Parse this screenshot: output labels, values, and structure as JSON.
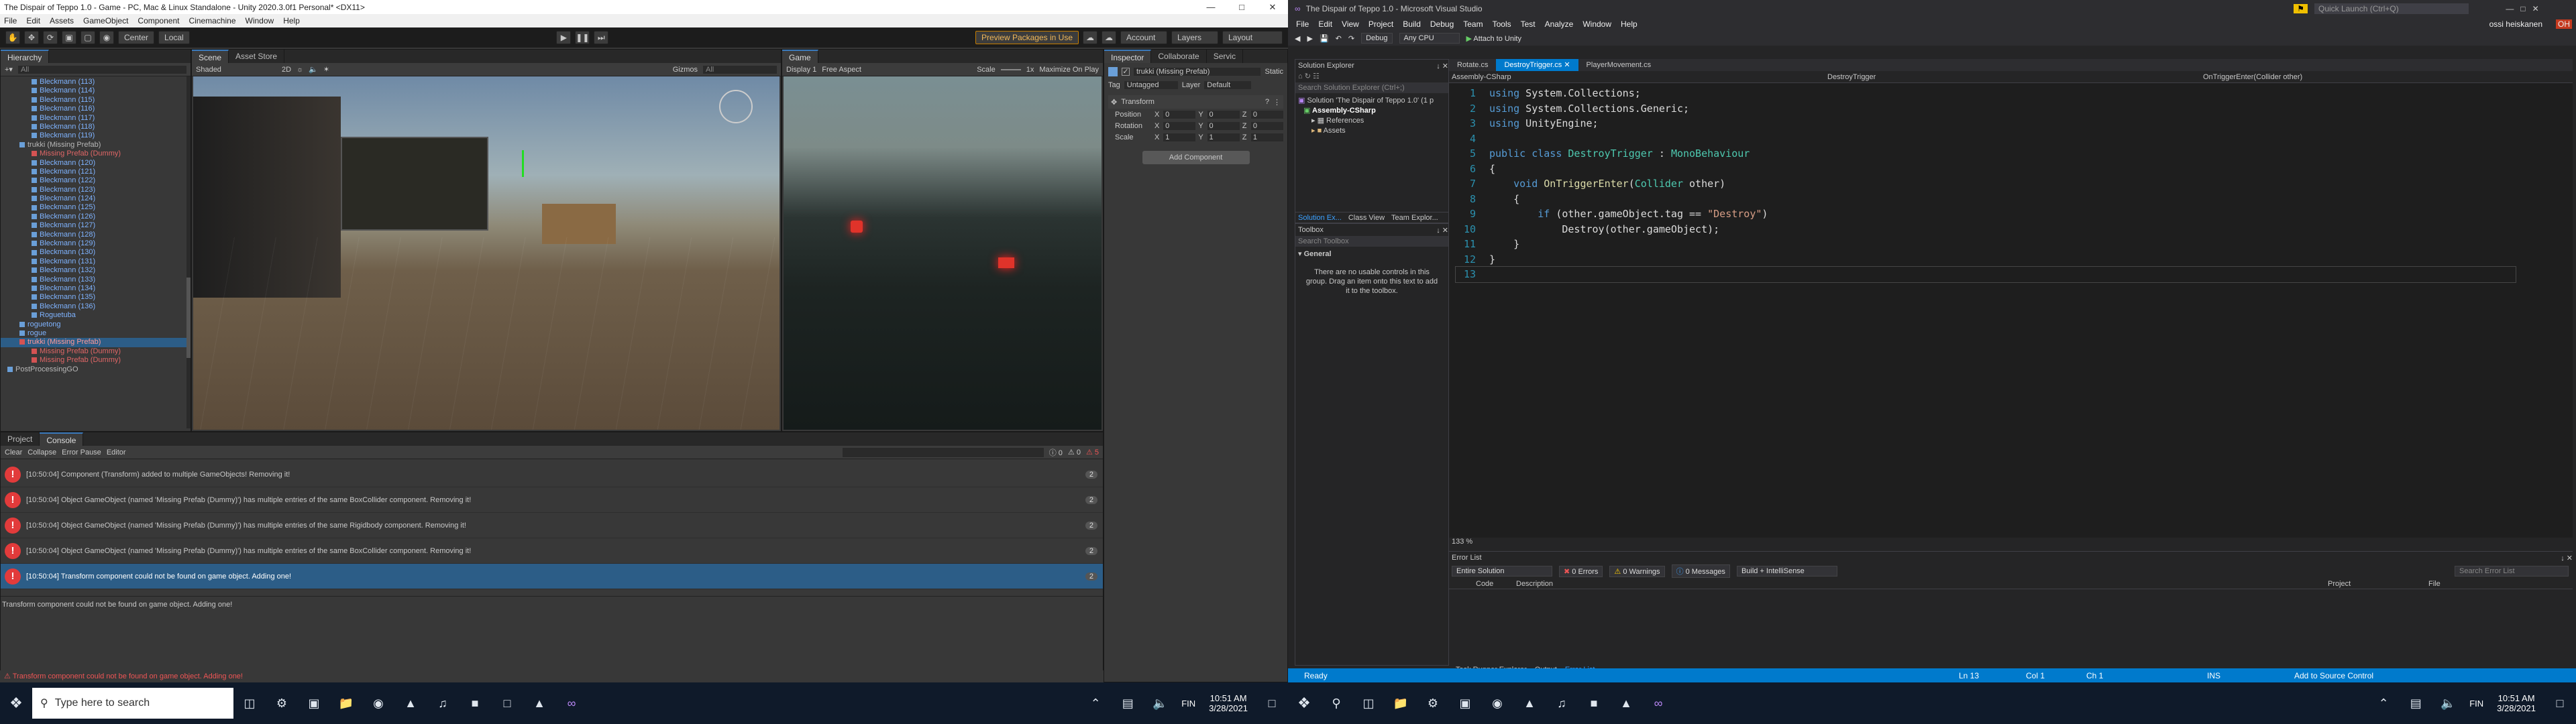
{
  "unity": {
    "title": "The Dispair of Teppo 1.0 - Game - PC, Mac & Linux Standalone - Unity 2020.3.0f1 Personal* <DX11>",
    "menu": [
      "File",
      "Edit",
      "Assets",
      "GameObject",
      "Component",
      "Cinemachine",
      "Window",
      "Help"
    ],
    "toolbar": {
      "center": "Center",
      "local": "Local",
      "preview": "Preview Packages in Use",
      "account": "Account",
      "layers": "Layers",
      "layout": "Layout"
    },
    "hierarchy": {
      "tab": "Hierarchy",
      "search_placeholder": "All",
      "items": [
        {
          "label": "Bleckmann (113)",
          "type": "blue",
          "indent": 2
        },
        {
          "label": "Bleckmann (114)",
          "type": "blue",
          "indent": 2
        },
        {
          "label": "Bleckmann (115)",
          "type": "blue",
          "indent": 2
        },
        {
          "label": "Bleckmann (116)",
          "type": "blue",
          "indent": 2
        },
        {
          "label": "Bleckmann (117)",
          "type": "blue",
          "indent": 2
        },
        {
          "label": "Bleckmann (118)",
          "type": "blue",
          "indent": 2
        },
        {
          "label": "Bleckmann (119)",
          "type": "blue",
          "indent": 2
        },
        {
          "label": "trukki (Missing Prefab)",
          "type": "plain",
          "indent": 1
        },
        {
          "label": "Missing Prefab (Dummy)",
          "type": "red",
          "indent": 2
        },
        {
          "label": "Bleckmann (120)",
          "type": "blue",
          "indent": 2
        },
        {
          "label": "Bleckmann (121)",
          "type": "blue",
          "indent": 2
        },
        {
          "label": "Bleckmann (122)",
          "type": "blue",
          "indent": 2
        },
        {
          "label": "Bleckmann (123)",
          "type": "blue",
          "indent": 2
        },
        {
          "label": "Bleckmann (124)",
          "type": "blue",
          "indent": 2
        },
        {
          "label": "Bleckmann (125)",
          "type": "blue",
          "indent": 2
        },
        {
          "label": "Bleckmann (126)",
          "type": "blue",
          "indent": 2
        },
        {
          "label": "Bleckmann (127)",
          "type": "blue",
          "indent": 2
        },
        {
          "label": "Bleckmann (128)",
          "type": "blue",
          "indent": 2
        },
        {
          "label": "Bleckmann (129)",
          "type": "blue",
          "indent": 2
        },
        {
          "label": "Bleckmann (130)",
          "type": "blue",
          "indent": 2
        },
        {
          "label": "Bleckmann (131)",
          "type": "blue",
          "indent": 2
        },
        {
          "label": "Bleckmann (132)",
          "type": "blue",
          "indent": 2
        },
        {
          "label": "Bleckmann (133)",
          "type": "blue",
          "indent": 2
        },
        {
          "label": "Bleckmann (134)",
          "type": "blue",
          "indent": 2
        },
        {
          "label": "Bleckmann (135)",
          "type": "blue",
          "indent": 2
        },
        {
          "label": "Bleckmann (136)",
          "type": "blue",
          "indent": 2
        },
        {
          "label": "Roguetuba",
          "type": "blue",
          "indent": 2
        },
        {
          "label": "roguetong",
          "type": "blue",
          "indent": 1
        },
        {
          "label": "rogue",
          "type": "blue",
          "indent": 1
        },
        {
          "label": "trukki (Missing Prefab)",
          "type": "redsel",
          "indent": 1
        },
        {
          "label": "Missing Prefab (Dummy)",
          "type": "red",
          "indent": 2
        },
        {
          "label": "Missing Prefab (Dummy)",
          "type": "red",
          "indent": 2
        },
        {
          "label": "PostProcessingGO",
          "type": "plain",
          "indent": 0
        }
      ]
    },
    "scene": {
      "tabs": [
        "Scene",
        "Asset Store"
      ],
      "shading": "Shaded",
      "mode": "2D",
      "gizmos": "Gizmos",
      "search": "All"
    },
    "game": {
      "tab": "Game",
      "display": "Display 1",
      "aspect": "Free Aspect",
      "scale": "Scale",
      "scale_val": "1x",
      "maximize": "Maximize On Play"
    },
    "inspector": {
      "tabs": [
        "Inspector",
        "Collaborate",
        "Servic"
      ],
      "object": "trukki (Missing Prefab)",
      "static": "Static",
      "tag_label": "Tag",
      "tag": "Untagged",
      "layer_label": "Layer",
      "layer": "Default",
      "transform": "Transform",
      "rows": [
        {
          "label": "Position",
          "x": "0",
          "y": "0",
          "z": "0"
        },
        {
          "label": "Rotation",
          "x": "0",
          "y": "0",
          "z": "0"
        },
        {
          "label": "Scale",
          "x": "1",
          "y": "1",
          "z": "1"
        }
      ],
      "add_component": "Add Component"
    },
    "console": {
      "tabs": [
        "Project",
        "Console"
      ],
      "buttons": [
        "Clear",
        "Collapse",
        "Error Pause",
        "Editor"
      ],
      "counts": {
        "log": "0",
        "warn": "0",
        "err": "5"
      },
      "rows": [
        {
          "text": "[10:50:04] Component (Transform) added to multiple GameObjects! Removing it!",
          "count": "2"
        },
        {
          "text": "[10:50:04] Object GameObject (named 'Missing Prefab (Dummy)') has multiple entries of the same BoxCollider component. Removing it!",
          "count": "2"
        },
        {
          "text": "[10:50:04] Object GameObject (named 'Missing Prefab (Dummy)') has multiple entries of the same Rigidbody component. Removing it!",
          "count": "2"
        },
        {
          "text": "[10:50:04] Object GameObject (named 'Missing Prefab (Dummy)') has multiple entries of the same BoxCollider component. Removing it!",
          "count": "2"
        },
        {
          "text": "[10:50:04] Transform component could not be found on game object. Adding one!",
          "count": "2"
        }
      ],
      "detail": "Transform component could not be found on game object. Adding one!"
    },
    "status": "Transform component could not be found on game object. Adding one!"
  },
  "taskbar_left": {
    "search": "Type here to search",
    "time": "10:51 AM",
    "date": "3/28/2021",
    "lang": "FIN"
  },
  "taskbar_right": {
    "time": "10:51 AM",
    "date": "3/28/2021",
    "lang": "FIN"
  },
  "vs": {
    "title": "The Dispair of Teppo 1.0 - Microsoft Visual Studio",
    "menu": [
      "File",
      "Edit",
      "View",
      "Project",
      "Build",
      "Debug",
      "Team",
      "Tools",
      "Test",
      "Analyze",
      "Window",
      "Help"
    ],
    "quick_launch": "Quick Launch (Ctrl+Q)",
    "user": "ossi heiskanen",
    "user_initials": "OH",
    "toolbar": {
      "config": "Debug",
      "platform": "Any CPU",
      "attach": "Attach to Unity"
    },
    "solution_explorer": {
      "title": "Solution Explorer",
      "search": "Search Solution Explorer (Ctrl+;)",
      "items": [
        "Solution 'The Dispair of Teppo 1.0' (1 p",
        "Assembly-CSharp",
        "References",
        "Assets"
      ],
      "tabs": [
        "Solution Ex...",
        "Class View",
        "Team Explor..."
      ]
    },
    "toolbox": {
      "title": "Toolbox",
      "search": "Search Toolbox",
      "group": "General",
      "empty": "There are no usable controls in this group. Drag an item onto this text to add it to the toolbox."
    },
    "doc_tabs": [
      "Rotate.cs",
      "DestroyTrigger.cs",
      "PlayerMovement.cs"
    ],
    "nav": {
      "project": "Assembly-CSharp",
      "class": "DestroyTrigger",
      "member": "OnTriggerEnter(Collider other)"
    },
    "zoom": "133 %",
    "error_list": {
      "title": "Error List",
      "scope": "Entire Solution",
      "errors": "0 Errors",
      "warnings": "0 Warnings",
      "messages": "0 Messages",
      "build": "Build + IntelliSense",
      "search": "Search Error List",
      "cols": [
        "Code",
        "Description",
        "Project",
        "File"
      ]
    },
    "bottom_tabs": [
      "Task Runner Explorer",
      "Output",
      "Error List"
    ],
    "status": {
      "ready": "Ready",
      "ln": "Ln 13",
      "col": "Col 1",
      "ch": "Ch 1",
      "ins": "INS",
      "add_source": "Add to Source Control"
    }
  }
}
